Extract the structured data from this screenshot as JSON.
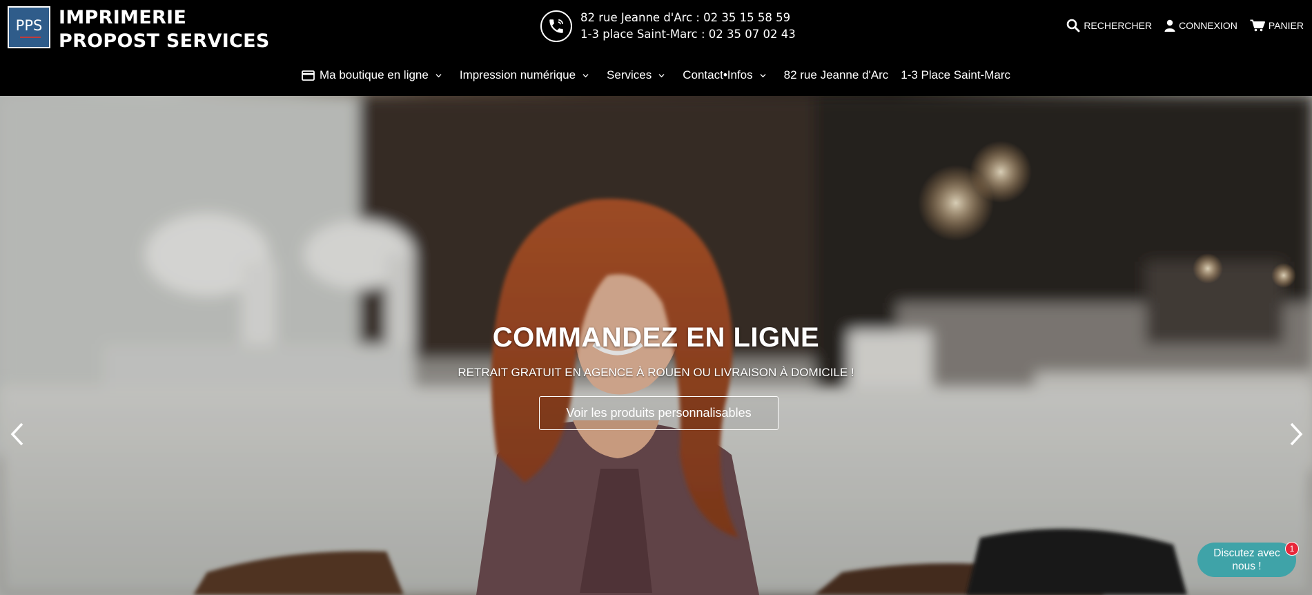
{
  "brand": {
    "logo_text": "PPS",
    "name_line1": "IMPRIMERIE",
    "name_line2": "PROPOST SERVICES"
  },
  "contact": {
    "icon": "phone-icon",
    "line1": "82 rue Jeanne d'Arc : 02 35 15 58 59",
    "line2": "1-3 place Saint-Marc : 02 35 07 02 43"
  },
  "utility": {
    "search_label": "RECHERCHER",
    "login_label": "CONNEXION",
    "cart_label": "PANIER"
  },
  "nav": {
    "items": [
      {
        "label": "Ma boutique en ligne",
        "icon": "credit-card-icon",
        "dropdown": true
      },
      {
        "label": "Impression numérique",
        "dropdown": true
      },
      {
        "label": "Services",
        "dropdown": true
      },
      {
        "label": "Contact•Infos",
        "dropdown": true
      },
      {
        "label": "82 rue Jeanne d'Arc",
        "dropdown": false
      },
      {
        "label": "1-3 Place Saint-Marc",
        "dropdown": false
      }
    ]
  },
  "hero": {
    "title": "COMMANDEZ EN LIGNE",
    "subtitle": "RETRAIT GRATUIT EN AGENCE À ROUEN OU LIVRAISON À DOMICILE !",
    "button_label": "Voir les produits personnalisables"
  },
  "chat": {
    "label_line1": "Discutez avec",
    "label_line2": "nous !",
    "badge_count": "1"
  },
  "colors": {
    "header_bg": "#000000",
    "logo_blue": "#2f5c8a",
    "chat_teal": "#3fa3a8",
    "badge_red": "#e8263a"
  }
}
